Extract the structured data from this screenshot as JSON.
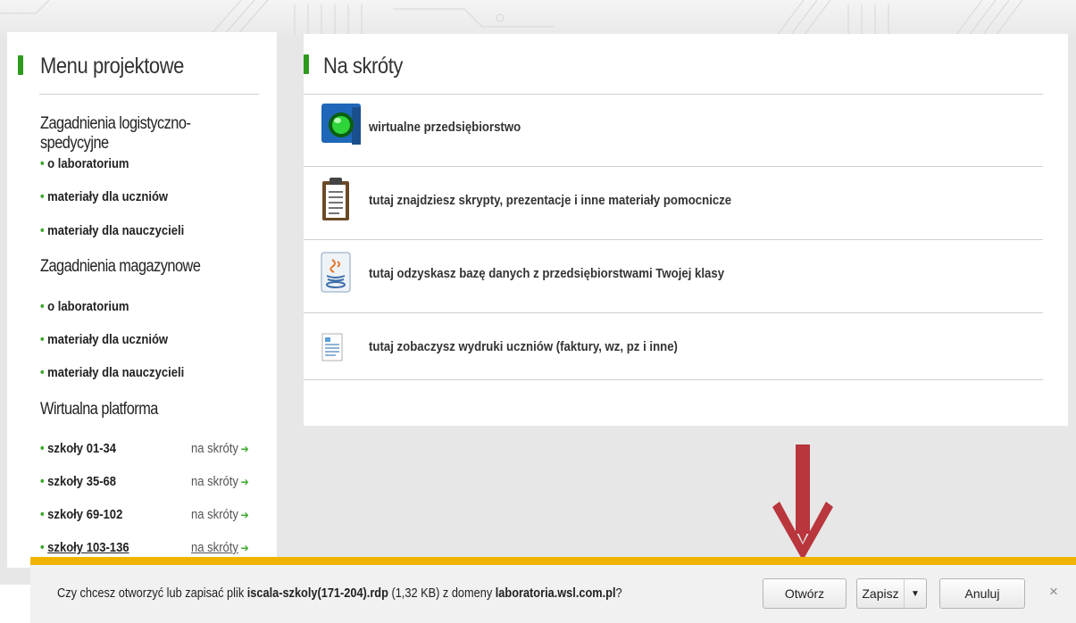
{
  "sidebar": {
    "title": "Menu projektowe",
    "sections": [
      {
        "heading": "Zagadnienia logistyczno-spedycyjne",
        "links": [
          "o laboratorium",
          "materiały dla uczniów",
          "materiały dla nauczycieli"
        ]
      },
      {
        "heading": "Zagadnienia magazynowe",
        "links": [
          "o laboratorium",
          "materiały dla uczniów",
          "materiały dla nauczycieli"
        ]
      },
      {
        "heading": "Wirtualna platforma",
        "schools": [
          {
            "label": "szkoły 01-34",
            "shortcut": "na skróty"
          },
          {
            "label": "szkoły 35-68",
            "shortcut": "na skróty"
          },
          {
            "label": "szkoły 69-102",
            "shortcut": "na skróty"
          },
          {
            "label": "szkoły 103-136",
            "shortcut": "na skróty"
          }
        ]
      }
    ]
  },
  "main": {
    "title": "Na skróty",
    "rows": [
      {
        "icon": "virtual-enterprise-icon",
        "text": "wirtualne przedsiębiorstwo"
      },
      {
        "icon": "clipboard-icon",
        "text": "tutaj znajdziesz skrypty, prezentacje i inne materiały pomocnicze"
      },
      {
        "icon": "java-icon",
        "text": "tutaj odzyskasz bazę danych z przedsiębiorstwami Twojej klasy"
      },
      {
        "icon": "document-icon",
        "text": "tutaj zobaczysz wydruki uczniów (faktury, wz, pz i inne)"
      }
    ]
  },
  "download_bar": {
    "msg_prefix": "Czy chcesz otworzyć lub zapisać plik ",
    "filename": "iscala-szkoly(171-204).rdp",
    "size": " (1,32 KB) z domeny ",
    "domain": "laboratoria.wsl.com.pl",
    "msg_suffix": "?",
    "open_label": "Otwórz",
    "save_label": "Zapisz",
    "cancel_label": "Anuluj",
    "close_glyph": "×",
    "accent_color": "#f0b400"
  },
  "colors": {
    "green": "#2e9a1d",
    "arrow_red": "#b8363c"
  }
}
